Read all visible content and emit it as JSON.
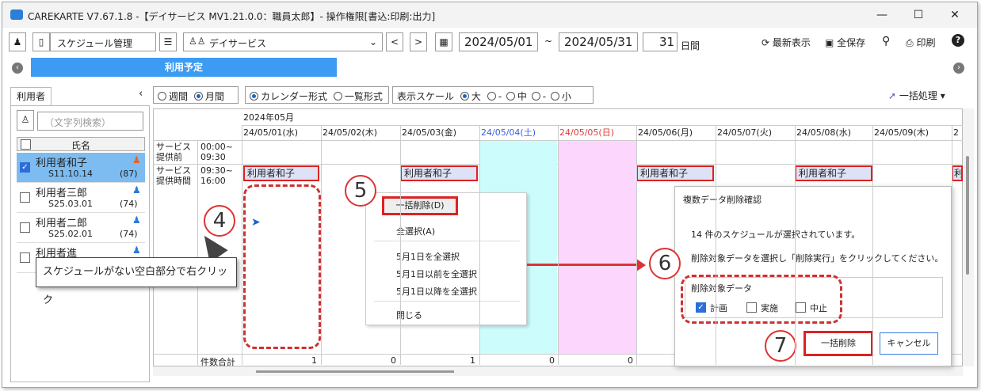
{
  "titlebar": {
    "title": "CAREKARTE V7.67.1.8 -【デイサービス MV1.21.0.0：職員太郎】- 操作権限[書込:印刷:出力]",
    "minimize": "—",
    "maximize": "☐",
    "close": "✕"
  },
  "toolbar": {
    "menu_label": "スケジュール管理",
    "service_label": "デイサービス",
    "date_from": "2024/05/01",
    "tilde": "~",
    "date_to": "2024/05/31",
    "days": "31",
    "days_unit": "日間",
    "refresh": "最新表示",
    "save_all": "全保存",
    "print": "印刷"
  },
  "banner": {
    "label": "利用予定"
  },
  "left_panel": {
    "tab": "利用者",
    "search_placeholder": "（文字列検索）",
    "col_name": "氏名",
    "users": [
      {
        "name": "利用者和子",
        "birth": "S11.10.14",
        "age": "(87)",
        "checked": true,
        "gender_color": "#e2662b"
      },
      {
        "name": "利用者三郎",
        "birth": "S25.03.01",
        "age": "(74)",
        "checked": false,
        "gender_color": "#2a7bd8"
      },
      {
        "name": "利用者二郎",
        "birth": "S25.02.01",
        "age": "(74)",
        "checked": false,
        "gender_color": "#2a7bd8"
      },
      {
        "name": "利用者進",
        "birth": "",
        "age": "",
        "checked": false,
        "gender_color": "#2a7bd8"
      }
    ]
  },
  "view_options": {
    "weekly": "週間",
    "monthly": "月間",
    "calendar": "カレンダー形式",
    "list": "一覧形式",
    "scale_label": "表示スケール",
    "scale_large": "大",
    "scale_mid": "中",
    "scale_small": "小",
    "sep": "-",
    "bulk": "一括処理"
  },
  "calendar": {
    "month": "2024年05月",
    "dates": [
      {
        "label": "24/05/01(水)",
        "color": "#222"
      },
      {
        "label": "24/05/02(木)",
        "color": "#222"
      },
      {
        "label": "24/05/03(金)",
        "color": "#222"
      },
      {
        "label": "24/05/04(土)",
        "color": "#3b5ee0"
      },
      {
        "label": "24/05/05(日)",
        "color": "#e03b3b"
      },
      {
        "label": "24/05/06(月)",
        "color": "#222"
      },
      {
        "label": "24/05/07(火)",
        "color": "#222"
      },
      {
        "label": "24/05/08(水)",
        "color": "#222"
      },
      {
        "label": "24/05/09(木)",
        "color": "#222"
      },
      {
        "label": "2",
        "color": "#222"
      }
    ],
    "row1_label": "サービス\n提供前",
    "row1_time": "00:00~\n09:30",
    "row2_label": "サービス\n提供時間",
    "row2_time": "09:30~\n16:00",
    "entry": "利用者和子",
    "entry_cut": "利",
    "total_label": "件数合計",
    "totals": [
      "1",
      "0",
      "1",
      "0",
      "0"
    ]
  },
  "context_menu": {
    "bulk_delete": "一括削除(D)",
    "select_all": "全選択(A)",
    "select_day": "5月1日を全選択",
    "select_before": "5月1日以前を全選択",
    "select_after": "5月1日以降を全選択",
    "close": "閉じる"
  },
  "dialog": {
    "title": "複数データ削除確認",
    "message1": "14 件のスケジュールが選択されています。",
    "message2": "削除対象データを選択し「削除実行」をクリックしてください。",
    "group_label": "削除対象データ",
    "opt_plan": "計画",
    "opt_actual": "実施",
    "opt_cancel": "中止",
    "delete_button": "一括削除",
    "cancel_button": "キャンセル"
  },
  "annotations": {
    "n4": "4",
    "n5": "5",
    "n6": "6",
    "n7": "7",
    "callout": "スケジュールがない空白部分で右クリック"
  }
}
